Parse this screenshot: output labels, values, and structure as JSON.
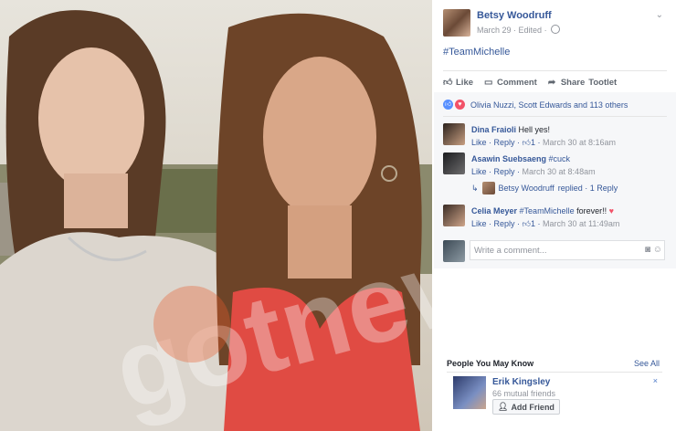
{
  "post": {
    "author": "Betsy Woodruff",
    "date": "March 29",
    "edited": "· Edited ·",
    "text": "#TeamMichelle"
  },
  "actions": {
    "like": "Like",
    "comment": "Comment",
    "share": "Share",
    "tootlet": "Tootlet"
  },
  "reactions": {
    "summary": "Olivia Nuzzi, Scott Edwards and 113 others"
  },
  "comments": [
    {
      "name": "Dina Fraioli",
      "text": "Hell yes!",
      "like": "Like",
      "reply": "Reply",
      "count": "1",
      "time": "March 30 at 8:16am"
    },
    {
      "name": "Asawin Suebsaeng",
      "text": "#cuck",
      "like": "Like",
      "reply": "Reply",
      "time": "March 30 at 8:48am",
      "reply_summary": {
        "name": "Betsy Woodruff",
        "text": "replied · 1 Reply"
      }
    },
    {
      "name": "Celia Meyer",
      "text_link": "#TeamMichelle",
      "text": "forever!!",
      "like": "Like",
      "reply": "Reply",
      "count": "1",
      "time": "March 30 at 11:49am"
    }
  ],
  "write_comment": {
    "placeholder": "Write a comment..."
  },
  "pymk": {
    "title": "People You May Know",
    "see_all": "See All",
    "name": "Erik Kingsley",
    "mutual": "66 mutual friends",
    "add": "Add Friend",
    "close": "×"
  },
  "watermark": "gotnews",
  "colors": {
    "link": "#365899",
    "accent_red": "#f25268",
    "like_blue": "#5890ff"
  }
}
